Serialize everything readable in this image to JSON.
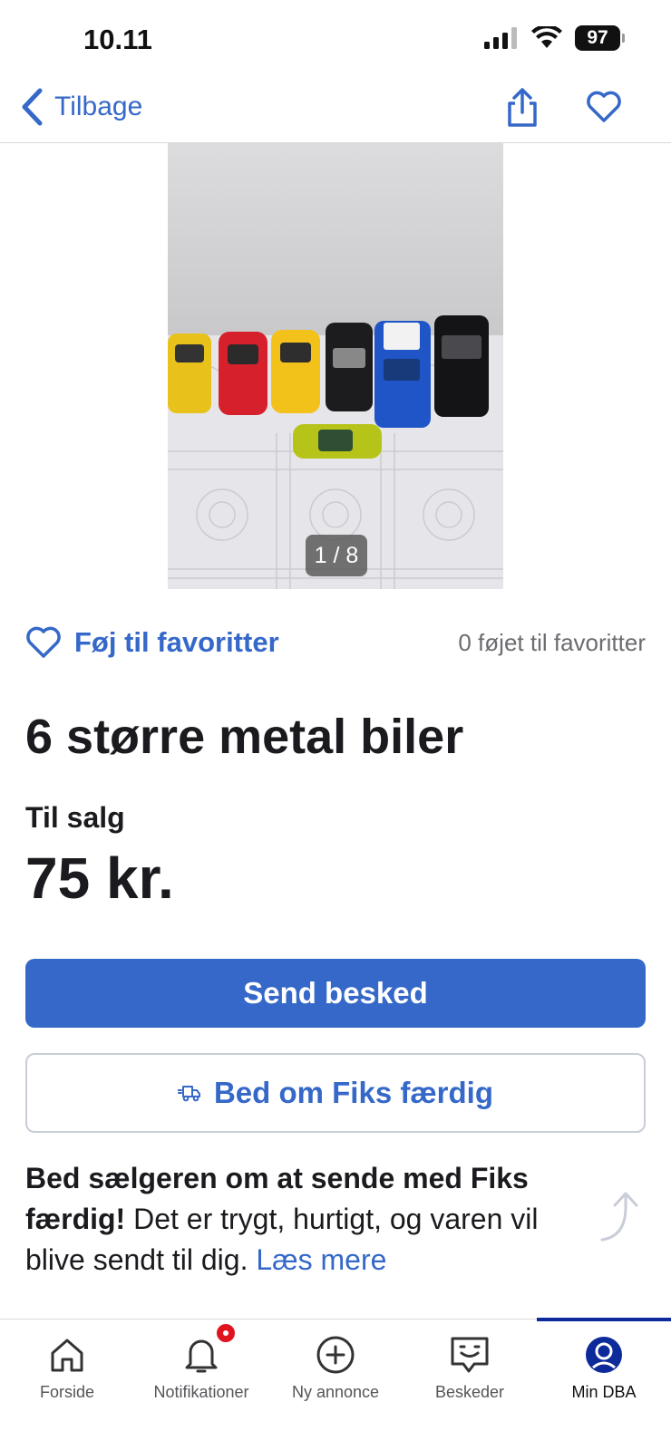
{
  "status_bar": {
    "time": "10.11",
    "battery": "97"
  },
  "nav": {
    "back_label": "Tilbage"
  },
  "gallery": {
    "pager": "1 / 8"
  },
  "favorites": {
    "add_label": "Føj til favoritter",
    "count_text": "0 føjet til favoritter"
  },
  "listing": {
    "title": "6 større metal biler",
    "type": "Til salg",
    "price": "75 kr."
  },
  "actions": {
    "send_label": "Send besked",
    "fiks_label": "Bed om Fiks færdig"
  },
  "info": {
    "bold": "Bed sælgeren om at sende med Fiks færdig!",
    "text": " Det er trygt, hurtigt, og varen vil blive sendt til dig. ",
    "link": "Læs mere"
  },
  "tabs": [
    {
      "label": "Forside",
      "icon": "home-icon"
    },
    {
      "label": "Notifikationer",
      "icon": "bell-icon"
    },
    {
      "label": "Ny annonce",
      "icon": "plus-circle-icon"
    },
    {
      "label": "Beskeder",
      "icon": "chat-icon"
    },
    {
      "label": "Min DBA",
      "icon": "profile-icon",
      "active": true
    }
  ],
  "colors": {
    "accent": "#3568c8",
    "notification": "#e0141e",
    "active_tab": "#0c2a9a"
  }
}
